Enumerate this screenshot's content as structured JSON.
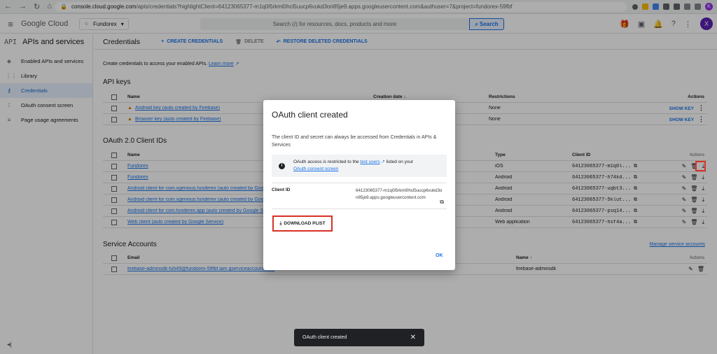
{
  "browser": {
    "url_host": "console.cloud.google.com",
    "url_path": "/apis/credentials?highlightClient=64123065377-m1q0l5rkml0hcl5uucp6vukd3on85je9.apps.googleusercontent.com&authuser=7&project=fundorex-59fbf",
    "profile_initial": "K"
  },
  "topbar": {
    "logo": "Google Cloud",
    "project": "Fundorex",
    "search_placeholder": "Search (/) for resources, docs, products and more",
    "search_button": "Search",
    "avatar": "X"
  },
  "sidebar": {
    "title_badge": "API",
    "title": "APIs and services",
    "items": [
      {
        "label": "Enabled APIs and services",
        "icon": "diamond-icon"
      },
      {
        "label": "Library",
        "icon": "library-icon"
      },
      {
        "label": "Credentials",
        "icon": "key-icon",
        "active": true
      },
      {
        "label": "OAuth consent screen",
        "icon": "consent-icon"
      },
      {
        "label": "Page usage agreements",
        "icon": "settings-list-icon"
      }
    ]
  },
  "main": {
    "title": "Credentials",
    "create": "CREATE CREDENTIALS",
    "delete": "DELETE",
    "restore": "RESTORE DELETED CREDENTIALS",
    "intro": "Create credentials to access your enabled APIs.",
    "learn_more": "Learn more",
    "api_keys": {
      "title": "API keys",
      "headers": {
        "name": "Name",
        "creation": "Creation date",
        "restrictions": "Restrictions",
        "actions": "Actions"
      },
      "rows": [
        {
          "name": "Android key (auto created by Firebase)",
          "restrictions": "None",
          "action": "SHOW KEY"
        },
        {
          "name": "Browser key (auto created by Firebase)",
          "restrictions": "None",
          "action": "SHOW KEY"
        }
      ]
    },
    "oauth": {
      "title": "OAuth 2.0 Client IDs",
      "headers": {
        "name": "Name",
        "type": "Type",
        "client_id": "Client ID",
        "actions": "Actions"
      },
      "rows": [
        {
          "name": "Fundorex",
          "type": "iOS",
          "client_id": "64123065377-m1q0l..."
        },
        {
          "name": "Fundorex",
          "type": "Android",
          "client_id": "64123065377-h74kd..."
        },
        {
          "name": "Android client for com.xgenious.funderex (auto created by Goo",
          "type": "Android",
          "client_id": "64123065377-uqbt3..."
        },
        {
          "name": "Android client for com.xgenious.funderex (auto created by Goo",
          "type": "Android",
          "client_id": "64123065377-5klut..."
        },
        {
          "name": "Android client for com.funderex.app (auto created by Google S",
          "type": "Android",
          "client_id": "64123065377-psq14..."
        },
        {
          "name": "Web client (auto created by Google Service)",
          "type": "Web application",
          "client_id": "64123065377-hsf4a..."
        }
      ]
    },
    "service_accounts": {
      "title": "Service Accounts",
      "manage": "Manage service accounts",
      "headers": {
        "email": "Email",
        "name": "Name",
        "actions": "Actions"
      },
      "rows": [
        {
          "email": "firebase-adminsdk-fuh49@fundorex-59fbf.iam.gserviceaccount.com",
          "name": "firebase-adminsdk"
        }
      ]
    }
  },
  "dialog": {
    "title": "OAuth client created",
    "text": "The client ID and secret can always be accessed from Credentials in APIs & Services",
    "info_prefix": "OAuth access is restricted to the",
    "info_link1": "test users",
    "info_mid": "listed on your",
    "info_link2": "OAuth consent screen",
    "client_id_label": "Client ID",
    "client_id_value": "64123065377-m1q0l5rkml0hcl5uucp6vukd3on85je9.apps.googleusercontent.com",
    "download": "DOWNLOAD PLIST",
    "ok": "OK"
  },
  "snackbar": {
    "text": "OAuth client created"
  },
  "colors": {
    "accent": "#1a73e8",
    "highlight": "#d93025",
    "warning": "#e37400"
  }
}
